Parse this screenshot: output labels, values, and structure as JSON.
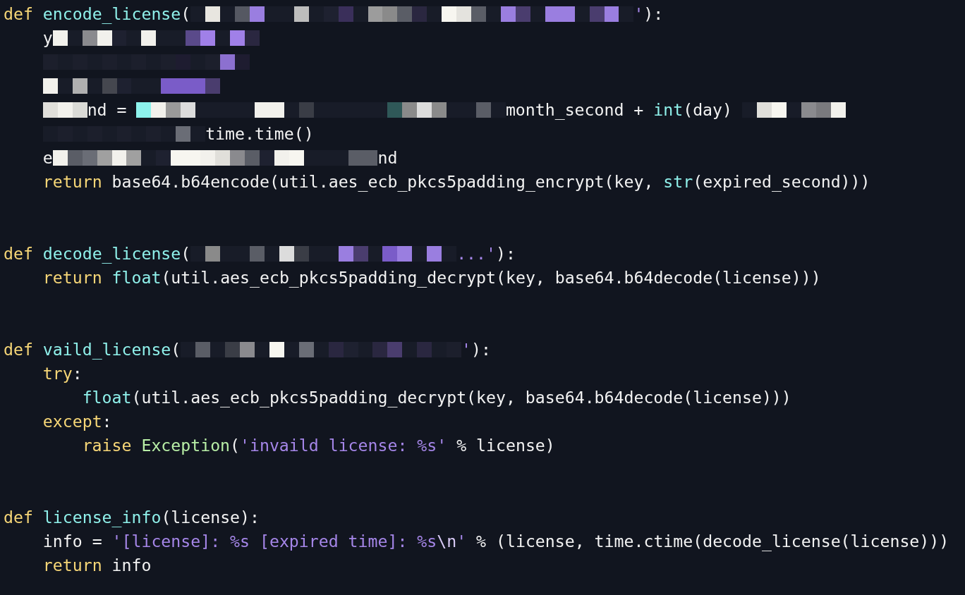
{
  "editor": {
    "lines": [
      {
        "kind": "code",
        "tokens": [
          {
            "kind": "keyword",
            "text": "def "
          },
          {
            "kind": "function",
            "text": "encode_license"
          },
          {
            "kind": "plain",
            "text": "("
          },
          {
            "kind": "redaction",
            "cells": [
              {
                "color": "#181c28"
              },
              {
                "color": "#e8e6e0"
              },
              {
                "color": "#181c28"
              },
              {
                "color": "#555862"
              },
              {
                "color": "#9a7ee0"
              },
              {
                "color": "#181c28"
              },
              {
                "color": "#181c28"
              },
              {
                "color": "#bdbdbd"
              },
              {
                "color": "#181c28"
              },
              {
                "color": "#1e2130"
              },
              {
                "color": "#3a2f5a"
              },
              {
                "color": "#181c28"
              },
              {
                "color": "#9c9c9c"
              },
              {
                "color": "#8a8a8a"
              },
              {
                "color": "#5a5d66"
              },
              {
                "color": "#2a2740"
              },
              {
                "color": "#181c28"
              },
              {
                "color": "#f7f6f0"
              },
              {
                "color": "#e4e3de"
              },
              {
                "color": "#5a5d66"
              },
              {
                "color": "#181c28"
              },
              {
                "color": "#9a7ee0"
              },
              {
                "color": "#4a3d6e"
              },
              {
                "color": "#181c28"
              },
              {
                "color": "#9a7ee0"
              },
              {
                "color": "#9a7ee0"
              },
              {
                "color": "#181c28"
              },
              {
                "color": "#4a3d6e"
              },
              {
                "color": "#9a7ee0"
              },
              {
                "color": "#181c28"
              }
            ]
          },
          {
            "kind": "string",
            "text": "'"
          },
          {
            "kind": "plain",
            "text": "):"
          }
        ],
        "children": [
          {
            "kind": "code",
            "tokens": [
              {
                "kind": "plain",
                "text": "y"
              },
              {
                "kind": "redaction",
                "cells": [
                  {
                    "color": "#f2f1ec"
                  },
                  {
                    "color": "#181c28"
                  },
                  {
                    "color": "#8a8a8e"
                  },
                  {
                    "color": "#f2f1ec"
                  },
                  {
                    "color": "#1e2130"
                  },
                  {
                    "color": "#181c28"
                  },
                  {
                    "color": "#f2f1ec"
                  },
                  {
                    "color": "#181c28"
                  },
                  {
                    "color": "#181c28"
                  },
                  {
                    "color": "#5a4a8a"
                  },
                  {
                    "color": "#a080e8"
                  },
                  {
                    "color": "#181c28"
                  },
                  {
                    "color": "#a080e8"
                  },
                  {
                    "color": "#2a2740"
                  }
                ]
              }
            ]
          },
          {
            "kind": "code",
            "tokens": [
              {
                "kind": "redaction",
                "cells": [
                  {
                    "color": "#1c1f2c"
                  },
                  {
                    "color": "#181c28"
                  },
                  {
                    "color": "#1c1f2c"
                  },
                  {
                    "color": "#181c28"
                  },
                  {
                    "color": "#1c1f2c"
                  },
                  {
                    "color": "#181c28"
                  },
                  {
                    "color": "#1c1f2c"
                  },
                  {
                    "color": "#181c28"
                  },
                  {
                    "color": "#1c1f2c"
                  },
                  {
                    "color": "#1e1c30"
                  },
                  {
                    "color": "#181c28"
                  },
                  {
                    "color": "#1c1f2c"
                  },
                  {
                    "color": "#8c70d0"
                  },
                  {
                    "color": "#1e1c30"
                  }
                ]
              }
            ]
          },
          {
            "kind": "code",
            "tokens": [
              {
                "kind": "redaction",
                "cells": [
                  {
                    "color": "#f2f1ec"
                  },
                  {
                    "color": "#181c28"
                  },
                  {
                    "color": "#b0b0b0"
                  },
                  {
                    "color": "#181c28"
                  },
                  {
                    "color": "#45474f"
                  },
                  {
                    "color": "#1e2130"
                  },
                  {
                    "color": "#181c28"
                  },
                  {
                    "color": "#181c28"
                  },
                  {
                    "color": "#7a5cc8"
                  },
                  {
                    "color": "#7a5cc8"
                  },
                  {
                    "color": "#7a5cc8"
                  },
                  {
                    "color": "#4a3d6e"
                  }
                ]
              }
            ]
          },
          {
            "kind": "code",
            "tokens": [
              {
                "kind": "redaction",
                "cells": [
                  {
                    "color": "#e0dfda"
                  },
                  {
                    "color": "#f2f1ec"
                  },
                  {
                    "color": "#dadad6"
                  }
                ]
              },
              {
                "kind": "plain",
                "text": "nd = "
              },
              {
                "kind": "redaction",
                "cells": [
                  {
                    "color": "#8df2ec"
                  },
                  {
                    "color": "#f2f1ec"
                  },
                  {
                    "color": "#9a9a9a"
                  },
                  {
                    "color": "#dcdcdc"
                  },
                  {
                    "color": "#181c28"
                  },
                  {
                    "color": "#181c28"
                  },
                  {
                    "color": "#181c28"
                  },
                  {
                    "color": "#181c28"
                  },
                  {
                    "color": "#f2f1ec"
                  },
                  {
                    "color": "#f2f1ec"
                  },
                  {
                    "color": "#181c28"
                  },
                  {
                    "color": "#3a3d46"
                  },
                  {
                    "color": "#181c28"
                  },
                  {
                    "color": "#181c28"
                  },
                  {
                    "color": "#181c28"
                  },
                  {
                    "color": "#181c28"
                  },
                  {
                    "color": "#181c28"
                  },
                  {
                    "color": "#2f5858"
                  },
                  {
                    "color": "#8a8a8a"
                  },
                  {
                    "color": "#dcdcdc"
                  },
                  {
                    "color": "#8a8a8a"
                  },
                  {
                    "color": "#181c28"
                  },
                  {
                    "color": "#181c28"
                  },
                  {
                    "color": "#5a5d66"
                  },
                  {
                    "color": "#181c28"
                  }
                ]
              },
              {
                "kind": "plain",
                "text": "month_second + "
              },
              {
                "kind": "builtin",
                "text": "int"
              },
              {
                "kind": "plain",
                "text": "(day) "
              },
              {
                "kind": "redaction",
                "cells": [
                  {
                    "color": "#181c28"
                  },
                  {
                    "color": "#e0dfda"
                  },
                  {
                    "color": "#f7f6f0"
                  },
                  {
                    "color": "#181c28"
                  },
                  {
                    "color": "#8a8a8e"
                  },
                  {
                    "color": "#7a7a7e"
                  },
                  {
                    "color": "#f2f1ec"
                  }
                ]
              }
            ]
          },
          {
            "kind": "code",
            "tokens": [
              {
                "kind": "redaction",
                "cells": [
                  {
                    "color": "#181c28"
                  },
                  {
                    "color": "#1c1f2c"
                  },
                  {
                    "color": "#181c28"
                  },
                  {
                    "color": "#1c1f2c"
                  },
                  {
                    "color": "#181c28"
                  },
                  {
                    "color": "#1c1f2c"
                  },
                  {
                    "color": "#181c28"
                  },
                  {
                    "color": "#1c1f2c"
                  },
                  {
                    "color": "#181c28"
                  },
                  {
                    "color": "#6a6d76"
                  },
                  {
                    "color": "#181c28"
                  }
                ]
              },
              {
                "kind": "plain",
                "text": "time.time()"
              }
            ]
          },
          {
            "kind": "code",
            "tokens": [
              {
                "kind": "plain",
                "text": "e"
              },
              {
                "kind": "redaction",
                "cells": [
                  {
                    "color": "#f2f1ec"
                  },
                  {
                    "color": "#5a5d66"
                  },
                  {
                    "color": "#6a6d76"
                  },
                  {
                    "color": "#a0a0a0"
                  },
                  {
                    "color": "#f2f1ec"
                  },
                  {
                    "color": "#a0a0a0"
                  },
                  {
                    "color": "#181c28"
                  },
                  {
                    "color": "#1e2130"
                  },
                  {
                    "color": "#f7f6f0"
                  },
                  {
                    "color": "#f7f6f0"
                  },
                  {
                    "color": "#f2f1ec"
                  },
                  {
                    "color": "#e0dfda"
                  },
                  {
                    "color": "#8a8a8e"
                  },
                  {
                    "color": "#5a5d66"
                  },
                  {
                    "color": "#1e2130"
                  },
                  {
                    "color": "#f2f1ec"
                  },
                  {
                    "color": "#f7f6f0"
                  },
                  {
                    "color": "#181c28"
                  },
                  {
                    "color": "#181c28"
                  },
                  {
                    "color": "#181c28"
                  },
                  {
                    "color": "#5a5d66"
                  },
                  {
                    "color": "#5a5d66"
                  }
                ]
              },
              {
                "kind": "plain",
                "text": "nd"
              }
            ]
          },
          {
            "kind": "code",
            "tokens": [
              {
                "kind": "keyword",
                "text": "return"
              },
              {
                "kind": "plain",
                "text": " base64.b64encode(util.aes_ecb_pkcs5padding_encrypt(key, "
              },
              {
                "kind": "builtin",
                "text": "str"
              },
              {
                "kind": "plain",
                "text": "(expired_second)))"
              }
            ]
          }
        ]
      },
      {
        "kind": "blank"
      },
      {
        "kind": "blank"
      },
      {
        "kind": "code",
        "tokens": [
          {
            "kind": "keyword",
            "text": "def "
          },
          {
            "kind": "function",
            "text": "decode_license"
          },
          {
            "kind": "plain",
            "text": "("
          },
          {
            "kind": "redaction",
            "cells": [
              {
                "color": "#181c28"
              },
              {
                "color": "#8a8a8a"
              },
              {
                "color": "#181c28"
              },
              {
                "color": "#181c28"
              },
              {
                "color": "#5a5d66"
              },
              {
                "color": "#181c28"
              },
              {
                "color": "#dcdcdc"
              },
              {
                "color": "#3a3d46"
              },
              {
                "color": "#181c28"
              },
              {
                "color": "#181c28"
              },
              {
                "color": "#9a7ee0"
              },
              {
                "color": "#4a3d6e"
              },
              {
                "color": "#181c28"
              },
              {
                "color": "#7a5cc8"
              },
              {
                "color": "#9a7ee0"
              },
              {
                "color": "#181c28"
              },
              {
                "color": "#9a7ee0"
              },
              {
                "color": "#181c28"
              }
            ]
          },
          {
            "kind": "string",
            "text": "...'"
          },
          {
            "kind": "plain",
            "text": "):"
          }
        ],
        "children": [
          {
            "kind": "code",
            "tokens": [
              {
                "kind": "keyword",
                "text": "return "
              },
              {
                "kind": "builtin",
                "text": "float"
              },
              {
                "kind": "plain",
                "text": "(util.aes_ecb_pkcs5padding_decrypt(key, base64.b64decode(license)))"
              }
            ]
          }
        ]
      },
      {
        "kind": "blank"
      },
      {
        "kind": "blank"
      },
      {
        "kind": "code",
        "tokens": [
          {
            "kind": "keyword",
            "text": "def "
          },
          {
            "kind": "function",
            "text": "vaild_license"
          },
          {
            "kind": "plain",
            "text": "("
          },
          {
            "kind": "redaction",
            "cells": [
              {
                "color": "#181c28"
              },
              {
                "color": "#5a5d66"
              },
              {
                "color": "#181c28"
              },
              {
                "color": "#3a3d46"
              },
              {
                "color": "#8a8a8e"
              },
              {
                "color": "#181c28"
              },
              {
                "color": "#f7f6f0"
              },
              {
                "color": "#181c28"
              },
              {
                "color": "#6a6d76"
              },
              {
                "color": "#181c28"
              },
              {
                "color": "#2a2740"
              },
              {
                "color": "#1e2130"
              },
              {
                "color": "#181c28"
              },
              {
                "color": "#2a2740"
              },
              {
                "color": "#4a3d6e"
              },
              {
                "color": "#181c28"
              },
              {
                "color": "#2a2740"
              },
              {
                "color": "#181c28"
              },
              {
                "color": "#1c1f2c"
              }
            ]
          },
          {
            "kind": "string",
            "text": "'"
          },
          {
            "kind": "plain",
            "text": "):"
          }
        ],
        "children": [
          {
            "kind": "code",
            "tokens": [
              {
                "kind": "keyword",
                "text": "try"
              },
              {
                "kind": "plain",
                "text": ":"
              }
            ],
            "children": [
              {
                "kind": "code",
                "tokens": [
                  {
                    "kind": "builtin",
                    "text": "float"
                  },
                  {
                    "kind": "plain",
                    "text": "(util.aes_ecb_pkcs5padding_decrypt(key, base64.b64decode(license)))"
                  }
                ]
              }
            ]
          },
          {
            "kind": "code",
            "tokens": [
              {
                "kind": "keyword",
                "text": "except"
              },
              {
                "kind": "plain",
                "text": ":"
              }
            ],
            "children": [
              {
                "kind": "code",
                "tokens": [
                  {
                    "kind": "keyword",
                    "text": "raise "
                  },
                  {
                    "kind": "class",
                    "text": "Exception"
                  },
                  {
                    "kind": "plain",
                    "text": "("
                  },
                  {
                    "kind": "string",
                    "text": "'invaild license: %s'"
                  },
                  {
                    "kind": "plain",
                    "text": " % license)"
                  }
                ]
              }
            ]
          }
        ]
      },
      {
        "kind": "blank"
      },
      {
        "kind": "blank"
      },
      {
        "kind": "code",
        "tokens": [
          {
            "kind": "keyword",
            "text": "def "
          },
          {
            "kind": "function",
            "text": "license_info"
          },
          {
            "kind": "plain",
            "text": "(license):"
          }
        ],
        "children": [
          {
            "kind": "code",
            "tokens": [
              {
                "kind": "plain",
                "text": "info = "
              },
              {
                "kind": "string",
                "text": "'[license]: %s [expired time]: %s"
              },
              {
                "kind": "escape",
                "text": "\\n"
              },
              {
                "kind": "string",
                "text": "'"
              },
              {
                "kind": "plain",
                "text": " % (license, time.ctime(decode_license(license)))"
              }
            ]
          },
          {
            "kind": "code",
            "tokens": [
              {
                "kind": "keyword",
                "text": "return"
              },
              {
                "kind": "plain",
                "text": " info"
              }
            ]
          }
        ]
      }
    ]
  }
}
